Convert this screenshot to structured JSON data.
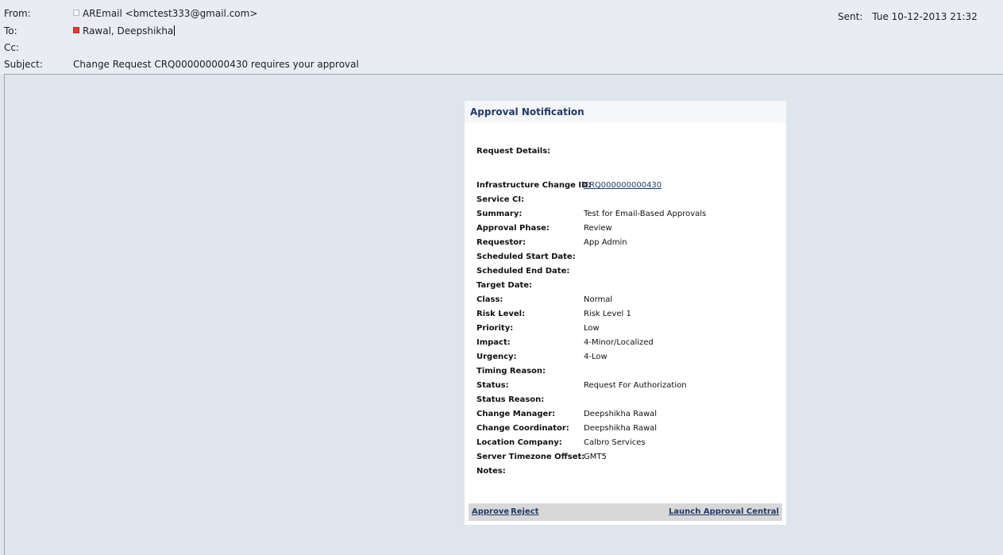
{
  "header": {
    "from_label": "From:",
    "from_value": "AREmail <bmctest333@gmail.com>",
    "to_label": "To:",
    "to_value": "Rawal, Deepshikha",
    "cc_label": "Cc:",
    "cc_value": "",
    "subject_label": "Subject:",
    "subject_value": "Change Request CRQ000000000430 requires your approval",
    "sent_label": "Sent:",
    "sent_value": "Tue 10-12-2013 21:32"
  },
  "card": {
    "title": "Approval Notification",
    "request_details": "Request Details:",
    "fields": [
      {
        "label": "Infrastructure Change ID:",
        "value": "CRQ000000000430",
        "link": true
      },
      {
        "label": "Service CI:",
        "value": ""
      },
      {
        "label": "Summary:",
        "value": "Test for Email-Based Approvals"
      },
      {
        "label": "Approval Phase:",
        "value": "Review"
      },
      {
        "label": "Requestor:",
        "value": "App Admin"
      },
      {
        "label": "Scheduled Start Date:",
        "value": ""
      },
      {
        "label": "Scheduled End Date:",
        "value": ""
      },
      {
        "label": "Target Date:",
        "value": ""
      },
      {
        "label": "Class:",
        "value": "Normal"
      },
      {
        "label": "Risk Level:",
        "value": "Risk Level 1"
      },
      {
        "label": "Priority:",
        "value": "Low"
      },
      {
        "label": "Impact:",
        "value": "4-Minor/Localized"
      },
      {
        "label": "Urgency:",
        "value": "4-Low"
      },
      {
        "label": "Timing Reason:",
        "value": ""
      },
      {
        "label": "Status:",
        "value": "Request For Authorization"
      },
      {
        "label": "Status Reason:",
        "value": ""
      },
      {
        "label": "Change Manager:",
        "value": "Deepshikha Rawal"
      },
      {
        "label": "Change Coordinator:",
        "value": "Deepshikha Rawal"
      },
      {
        "label": "Location Company:",
        "value": "Calbro Services"
      },
      {
        "label": "Server Timezone Offset:",
        "value": "GMT5"
      },
      {
        "label": "Notes:",
        "value": ""
      }
    ],
    "footer": {
      "approve": "Approve",
      "reject": "Reject",
      "launch": "Launch Approval Central"
    }
  },
  "colors": {
    "header_bg": "#e9edf3",
    "body_bg": "#dfe5ed",
    "title_text": "#1f3b6b",
    "footer_bg": "#d8d8d8",
    "presence_red": "#d9412c"
  }
}
